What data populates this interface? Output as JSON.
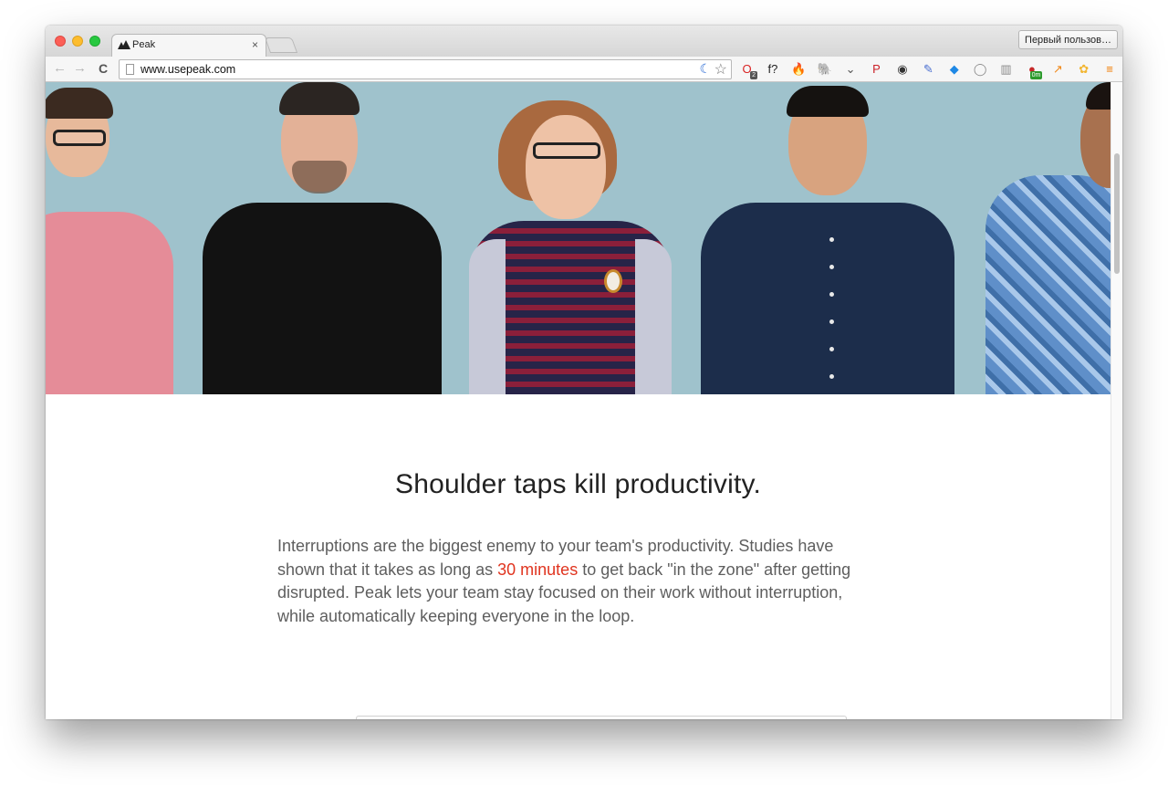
{
  "browser": {
    "tab_title": "Peak",
    "tab_close": "×",
    "profile_button": "Первый пользов…",
    "url": "www.usepeak.com",
    "nav": {
      "back": "←",
      "forward": "→",
      "reload": "C"
    },
    "extensions": [
      {
        "name": "opera-icon",
        "glyph": "O",
        "color": "#d92323",
        "badge": "2"
      },
      {
        "name": "font-identifier-icon",
        "glyph": "f?",
        "color": "#222222"
      },
      {
        "name": "fire-icon",
        "glyph": "🔥",
        "color": "#e8641c"
      },
      {
        "name": "evernote-icon",
        "glyph": "🐘",
        "color": "#555555"
      },
      {
        "name": "pocket-icon",
        "glyph": "⌄",
        "color": "#555555"
      },
      {
        "name": "pinterest-icon",
        "glyph": "P",
        "color": "#cb2027"
      },
      {
        "name": "camera-icon",
        "glyph": "◉",
        "color": "#333333"
      },
      {
        "name": "eyedropper-icon",
        "glyph": "✎",
        "color": "#4a6fd0"
      },
      {
        "name": "diamond-icon",
        "glyph": "◆",
        "color": "#1e88e5"
      },
      {
        "name": "circle-icon",
        "glyph": "◯",
        "color": "#888888"
      },
      {
        "name": "reader-icon",
        "glyph": "▥",
        "color": "#888888"
      },
      {
        "name": "timer-icon",
        "glyph": "●",
        "color": "#c62828",
        "badge": "0m"
      },
      {
        "name": "analytics-icon",
        "glyph": "↗",
        "color": "#f08a1c"
      },
      {
        "name": "flower-icon",
        "glyph": "✿",
        "color": "#f2b632"
      },
      {
        "name": "menu-icon",
        "glyph": "≡",
        "color": "#f07b00"
      }
    ]
  },
  "hero": {
    "background": "#9fc2cc"
  },
  "content": {
    "headline": "Shoulder taps kill productivity.",
    "intro_part1": "Interruptions are the biggest enemy to your team's productivity. Studies have shown that it takes as long as ",
    "intro_link": "30 minutes",
    "intro_part2": " to get back \"in the zone\" after getting disrupted. Peak lets your team stay focused on their work without interruption, while automatically keeping everyone in the loop.",
    "accent_color": "#e0341f"
  }
}
